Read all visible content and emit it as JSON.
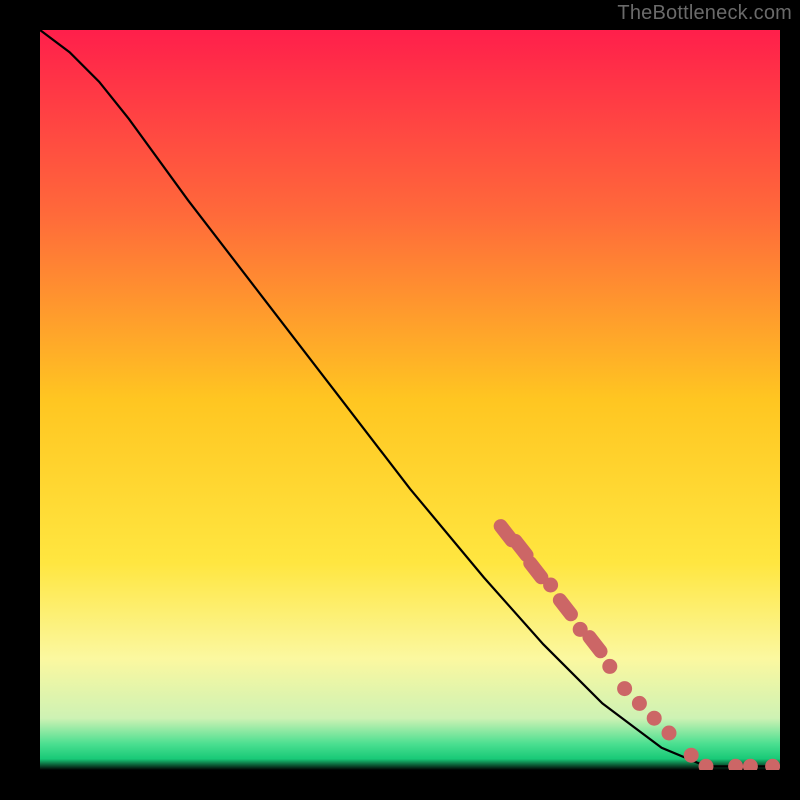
{
  "attribution": "TheBottleneck.com",
  "chart_data": {
    "type": "line",
    "xlim": [
      0,
      100
    ],
    "ylim": [
      0,
      100
    ],
    "curve": [
      {
        "x": 0,
        "y": 100
      },
      {
        "x": 4,
        "y": 97
      },
      {
        "x": 8,
        "y": 93
      },
      {
        "x": 12,
        "y": 88
      },
      {
        "x": 20,
        "y": 77
      },
      {
        "x": 30,
        "y": 64
      },
      {
        "x": 40,
        "y": 51
      },
      {
        "x": 50,
        "y": 38
      },
      {
        "x": 60,
        "y": 26
      },
      {
        "x": 68,
        "y": 17
      },
      {
        "x": 76,
        "y": 9
      },
      {
        "x": 84,
        "y": 3
      },
      {
        "x": 90,
        "y": 0.5
      },
      {
        "x": 100,
        "y": 0.5
      }
    ],
    "markers": [
      {
        "x": 63,
        "y": 32,
        "kind": "elongated"
      },
      {
        "x": 65,
        "y": 30,
        "kind": "elongated"
      },
      {
        "x": 67,
        "y": 27,
        "kind": "elongated"
      },
      {
        "x": 69,
        "y": 25,
        "kind": "round"
      },
      {
        "x": 71,
        "y": 22,
        "kind": "elongated"
      },
      {
        "x": 73,
        "y": 19,
        "kind": "round"
      },
      {
        "x": 75,
        "y": 17,
        "kind": "elongated"
      },
      {
        "x": 77,
        "y": 14,
        "kind": "round"
      },
      {
        "x": 79,
        "y": 11,
        "kind": "round"
      },
      {
        "x": 81,
        "y": 9,
        "kind": "round"
      },
      {
        "x": 83,
        "y": 7,
        "kind": "round"
      },
      {
        "x": 85,
        "y": 5,
        "kind": "round"
      },
      {
        "x": 88,
        "y": 2,
        "kind": "round"
      },
      {
        "x": 90,
        "y": 0.5,
        "kind": "round"
      },
      {
        "x": 94,
        "y": 0.5,
        "kind": "round"
      },
      {
        "x": 96,
        "y": 0.5,
        "kind": "round"
      },
      {
        "x": 99,
        "y": 0.5,
        "kind": "round"
      }
    ],
    "gradient_stops": [
      {
        "offset": 0.0,
        "color": "#ff1f4b"
      },
      {
        "offset": 0.25,
        "color": "#ff6a3a"
      },
      {
        "offset": 0.5,
        "color": "#ffc621"
      },
      {
        "offset": 0.72,
        "color": "#ffe640"
      },
      {
        "offset": 0.85,
        "color": "#fbf8a0"
      },
      {
        "offset": 0.93,
        "color": "#cef2b4"
      },
      {
        "offset": 0.965,
        "color": "#4adf90"
      },
      {
        "offset": 0.985,
        "color": "#18c977"
      },
      {
        "offset": 1.0,
        "color": "#000000"
      }
    ],
    "marker_color": "#cc6666",
    "curve_color": "#000000"
  }
}
